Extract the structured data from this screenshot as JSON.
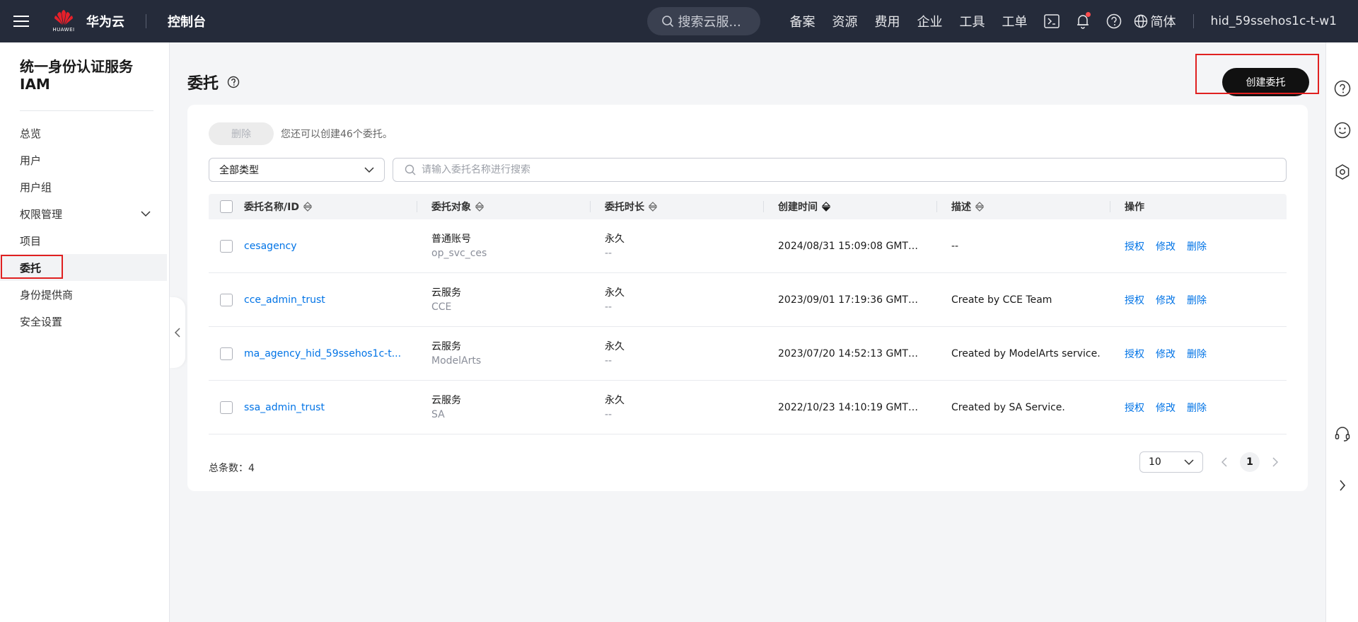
{
  "topbar": {
    "brand_sub": "HUAWEI",
    "brand": "华为云",
    "console": "控制台",
    "search_placeholder": "搜索云服...",
    "links": [
      "备案",
      "资源",
      "费用",
      "企业",
      "工具",
      "工单"
    ],
    "lang": "简体",
    "user": "hid_59ssehos1c-t-w1"
  },
  "sidebar": {
    "title": "统一身份认证服务IAM",
    "items": [
      {
        "label": "总览"
      },
      {
        "label": "用户"
      },
      {
        "label": "用户组"
      },
      {
        "label": "权限管理"
      },
      {
        "label": "项目"
      },
      {
        "label": "委托"
      },
      {
        "label": "身份提供商"
      },
      {
        "label": "安全设置"
      }
    ],
    "active_index": 5
  },
  "page": {
    "title": "委托",
    "create_button": "创建委托",
    "delete_button": "删除",
    "quota_text": "您还可以创建46个委托。",
    "type_filter": "全部类型",
    "search_placeholder": "请输入委托名称进行搜索"
  },
  "table": {
    "columns": [
      "委托名称/ID",
      "委托对象",
      "委托时长",
      "创建时间",
      "描述",
      "操作"
    ],
    "rows": [
      {
        "name": "cesagency",
        "obj_type": "普通账号",
        "obj_id": "op_svc_ces",
        "duration": "永久",
        "duration_sub": "--",
        "created": "2024/08/31 15:09:08 GMT+...",
        "desc": "--"
      },
      {
        "name": "cce_admin_trust",
        "obj_type": "云服务",
        "obj_id": "CCE",
        "duration": "永久",
        "duration_sub": "--",
        "created": "2023/09/01 17:19:36 GMT+...",
        "desc": "Create by CCE Team"
      },
      {
        "name": "ma_agency_hid_59ssehos1c-t...",
        "obj_type": "云服务",
        "obj_id": "ModelArts",
        "duration": "永久",
        "duration_sub": "--",
        "created": "2023/07/20 14:52:13 GMT+...",
        "desc": "Created by ModelArts service."
      },
      {
        "name": "ssa_admin_trust",
        "obj_type": "云服务",
        "obj_id": "SA",
        "duration": "永久",
        "duration_sub": "--",
        "created": "2022/10/23 14:10:19 GMT+...",
        "desc": "Created by SA Service."
      }
    ],
    "ops": [
      "授权",
      "修改",
      "删除"
    ]
  },
  "footer": {
    "total_label": "总条数：",
    "total": "4",
    "page_size": "10",
    "current_page": "1"
  }
}
